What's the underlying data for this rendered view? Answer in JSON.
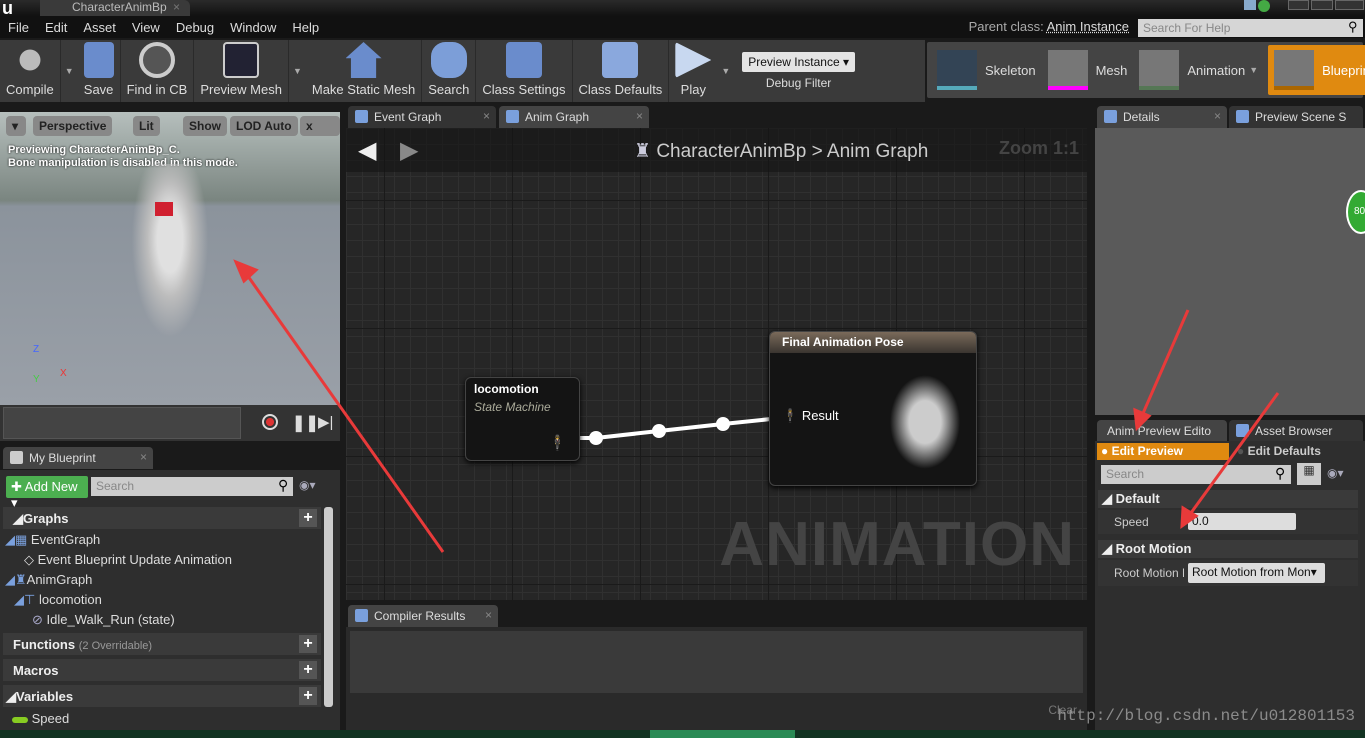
{
  "window": {
    "tab_title": "CharacterAnimBp",
    "parent_class_label": "Parent class:",
    "parent_class": "Anim Instance",
    "help_search_placeholder": "Search For Help"
  },
  "menu": [
    "File",
    "Edit",
    "Asset",
    "View",
    "Debug",
    "Window",
    "Help"
  ],
  "toolbar": {
    "compile": "Compile",
    "save": "Save",
    "find_in_cb": "Find in CB",
    "preview_mesh": "Preview Mesh",
    "make_static_mesh": "Make Static Mesh",
    "search": "Search",
    "class_settings": "Class Settings",
    "class_defaults": "Class Defaults",
    "play": "Play",
    "debug_select": "Preview Instance",
    "debug_filter": "Debug Filter"
  },
  "modes": [
    {
      "label": "Skeleton"
    },
    {
      "label": "Mesh"
    },
    {
      "label": "Animation"
    },
    {
      "label": "Blueprint",
      "active": true
    }
  ],
  "viewport": {
    "perspective": "Perspective",
    "lit": "Lit",
    "show": "Show",
    "lod": "LOD Auto",
    "speed": "x",
    "info1": "Previewing CharacterAnimBp_C.",
    "info2": "Bone manipulation is disabled in this mode.",
    "axis_z": "Z",
    "axis_y": "Y",
    "axis_x": "X"
  },
  "graph": {
    "tabs": [
      "Event Graph",
      "Anim Graph"
    ],
    "breadcrumb_root": "CharacterAnimBp",
    "breadcrumb_sep": ">",
    "breadcrumb_leaf": "Anim Graph",
    "zoom": "Zoom 1:1",
    "watermark": "ANIMATION",
    "node_sm_title": "locomotion",
    "node_sm_sub": "State Machine",
    "node_final_title": "Final Animation Pose",
    "node_final_pin": "Result"
  },
  "compiler": {
    "tab": "Compiler Results",
    "clear": "Clear"
  },
  "my_blueprint": {
    "tab": "My Blueprint",
    "add_new": "Add New",
    "search_placeholder": "Search",
    "graphs": "Graphs",
    "event_graph": "EventGraph",
    "event_update": "Event Blueprint Update Animation",
    "anim_graph": "AnimGraph",
    "locomotion": "locomotion",
    "state": "Idle_Walk_Run (state)",
    "functions": "Functions",
    "functions_note": "(2 Overridable)",
    "macros": "Macros",
    "variables": "Variables",
    "var_speed": "Speed"
  },
  "details": {
    "tab": "Details",
    "tab2": "Preview Scene S"
  },
  "preview_editor": {
    "tab": "Anim Preview Edito",
    "tab2": "Asset Browser",
    "edit_preview": "Edit Preview",
    "edit_defaults": "Edit Defaults",
    "search_placeholder": "Search",
    "default_section": "Default",
    "speed_label": "Speed",
    "speed_value": "0.0",
    "root_section": "Root Motion",
    "root_label": "Root Motion M",
    "root_value": "Root Motion from Mon"
  },
  "watermark": "http://blog.csdn.net/u012801153",
  "colors": {
    "accent": "#e08a10",
    "add_new": "#4caf50",
    "annotation_arrow": "#e83a3a"
  }
}
